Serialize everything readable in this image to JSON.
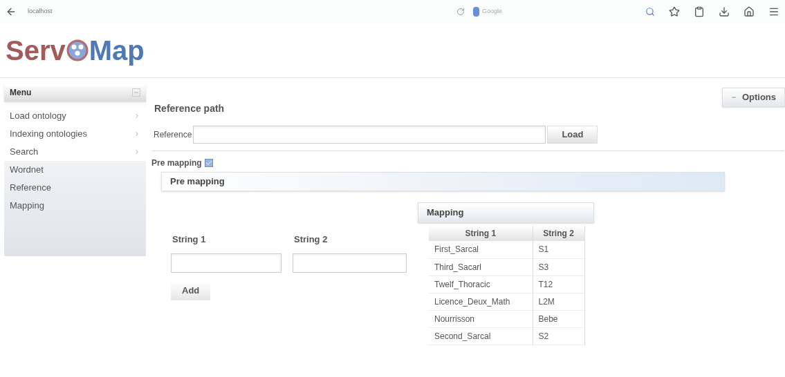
{
  "browser": {
    "url": "localhost",
    "search_placeholder": "Google"
  },
  "logo": {
    "left": "Serv",
    "right": "Map"
  },
  "menu": {
    "title": "Menu",
    "items": [
      {
        "label": "Load ontology",
        "kind": "submenu"
      },
      {
        "label": "Indexing ontologies",
        "kind": "submenu"
      },
      {
        "label": "Search",
        "kind": "submenu"
      },
      {
        "label": "Wordnet",
        "kind": "link"
      },
      {
        "label": "Reference",
        "kind": "link"
      },
      {
        "label": "Mapping",
        "kind": "link"
      }
    ]
  },
  "options_button": "Options",
  "reference": {
    "heading": "Reference path",
    "label": "Reference",
    "button": "Load"
  },
  "premapping": {
    "label": "Pre mapping",
    "checked": true,
    "panel_title": "Pre mapping"
  },
  "form": {
    "label_1": "String 1",
    "label_2": "String 2",
    "button": "Add"
  },
  "mapping": {
    "title": "Mapping",
    "columns": [
      "String 1",
      "String 2"
    ],
    "rows": [
      [
        "First_Sarcal",
        "S1"
      ],
      [
        "Third_Sacarl",
        "S3"
      ],
      [
        "Twelf_Thoracic",
        "T12"
      ],
      [
        "Licence_Deux_Math",
        "L2M"
      ],
      [
        "Nourrisson",
        "Bebe"
      ],
      [
        "Second_Sarcal",
        "S2"
      ]
    ]
  }
}
